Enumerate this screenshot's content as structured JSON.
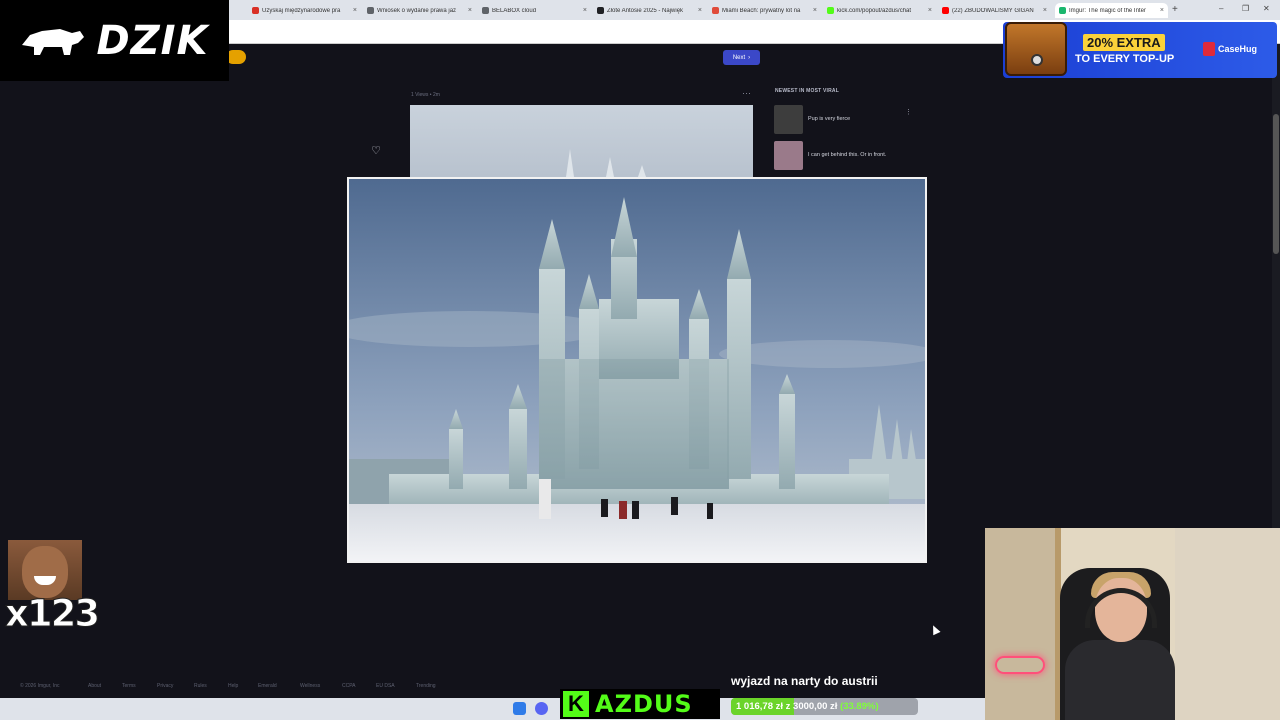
{
  "browser": {
    "tabs": [
      {
        "title": "Uzyskaj międzynarodowe pra",
        "color": "#d93025"
      },
      {
        "title": "Wniosek o wydanie prawa jaz",
        "color": "#5f6368"
      },
      {
        "title": "BELABOX cloud",
        "color": "#5f6368"
      },
      {
        "title": "Złote Antosie 2025 - Najwięk",
        "color": "#202124"
      },
      {
        "title": "Miami Beach: prywatny lot na",
        "color": "#e04b3a"
      },
      {
        "title": "kick.com/popout/azdus/chat",
        "color": "#53fc18"
      },
      {
        "title": "(22) ZBUDOWALIŚMY GIGAN",
        "color": "#ff0000"
      },
      {
        "title": "Imgur: The magic of the Inter",
        "color": "#1bb76e"
      }
    ],
    "new_tab": "+",
    "window_controls": [
      "–",
      "❐",
      "✕"
    ]
  },
  "imgur": {
    "next_label": "Next",
    "post_meta": "1 Views • 2m",
    "more": "···",
    "sidebar_title": "NEWEST IN MOST VIRAL",
    "sidebar_items": [
      {
        "title": "Pup is very fierce",
        "thumb": "#3d3d3d"
      },
      {
        "title": "I can get behind this. Or in front.",
        "thumb": "#9a7a8a"
      }
    ],
    "sidebar_more": "⋮"
  },
  "footer": {
    "links": [
      "© 2026 Imgur, Inc",
      "About",
      "Terms",
      "Privacy",
      "Rules",
      "Help",
      "Emerald",
      "Wellness",
      "CCPA",
      "EU DSA",
      "Trending"
    ]
  },
  "overlays": {
    "brand": "DZIK",
    "brand_mark": "®",
    "ad_line1": "20% EXTRA",
    "ad_line2": "TO EVERY TOP-UP",
    "ad_brand": "CaseHug",
    "emote_count": "x123",
    "goal_title": "wyjazd na narty do austrii",
    "goal_current": "1 016,78 zł",
    "goal_sep": "z",
    "goal_target": "3000,00 zł",
    "goal_percent": "(33.89%)",
    "goal_fraction": 0.3389,
    "channel_letter": "K",
    "channel_name": "AZDUS"
  }
}
